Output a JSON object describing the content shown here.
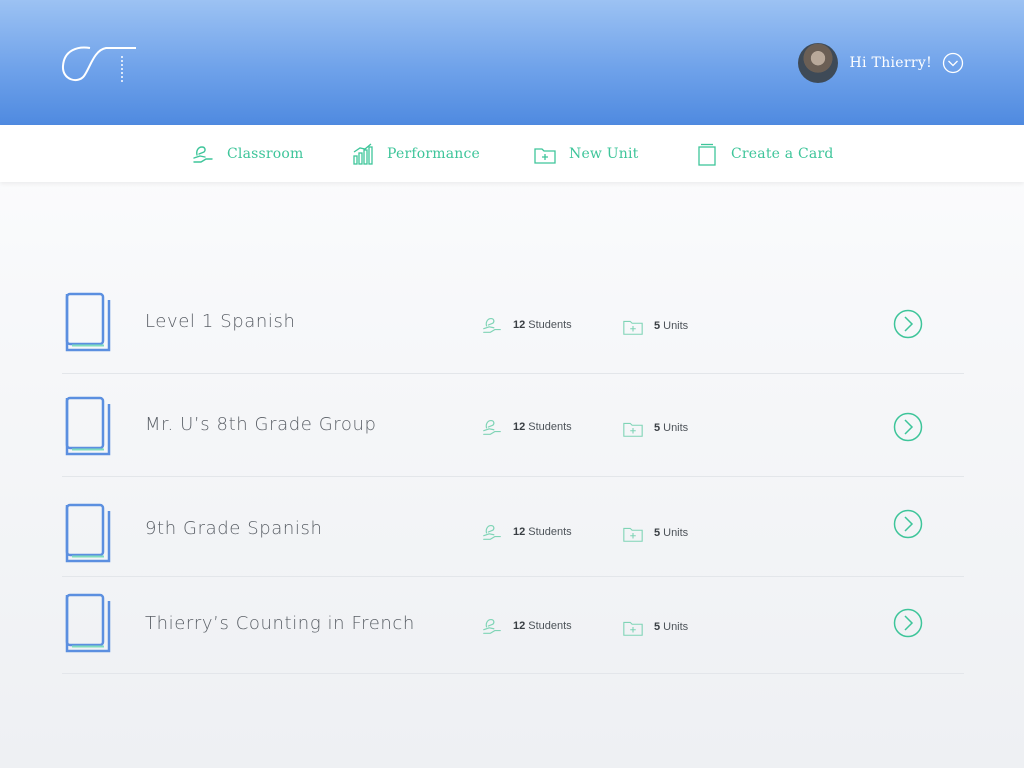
{
  "header": {
    "greeting": "Hi Thierry!"
  },
  "nav": [
    {
      "label": "Classroom",
      "icon": "hand-icon"
    },
    {
      "label": "Performance",
      "icon": "bar-chart-icon"
    },
    {
      "label": "New Unit",
      "icon": "folder-plus-icon"
    },
    {
      "label": "Create a Card",
      "icon": "card-icon"
    }
  ],
  "classes": [
    {
      "title": "Level 1 Spanish",
      "students_count": "12",
      "students_label": "Students",
      "units_count": "5",
      "units_label": "Units"
    },
    {
      "title": "Mr. U’s 8th Grade Group",
      "students_count": "12",
      "students_label": "Students",
      "units_count": "5",
      "units_label": "Units"
    },
    {
      "title": "9th Grade Spanish",
      "students_count": "12",
      "students_label": "Students",
      "units_count": "5",
      "units_label": "Units"
    },
    {
      "title": "Thierry’s Counting in French",
      "students_count": "12",
      "students_label": "Students",
      "units_count": "5",
      "units_label": "Units"
    }
  ],
  "colors": {
    "accent_green": "#3ec59a",
    "book_blue": "#5b8fe0",
    "header_top": "#9cc2f3",
    "header_bottom": "#4f8ae0"
  }
}
